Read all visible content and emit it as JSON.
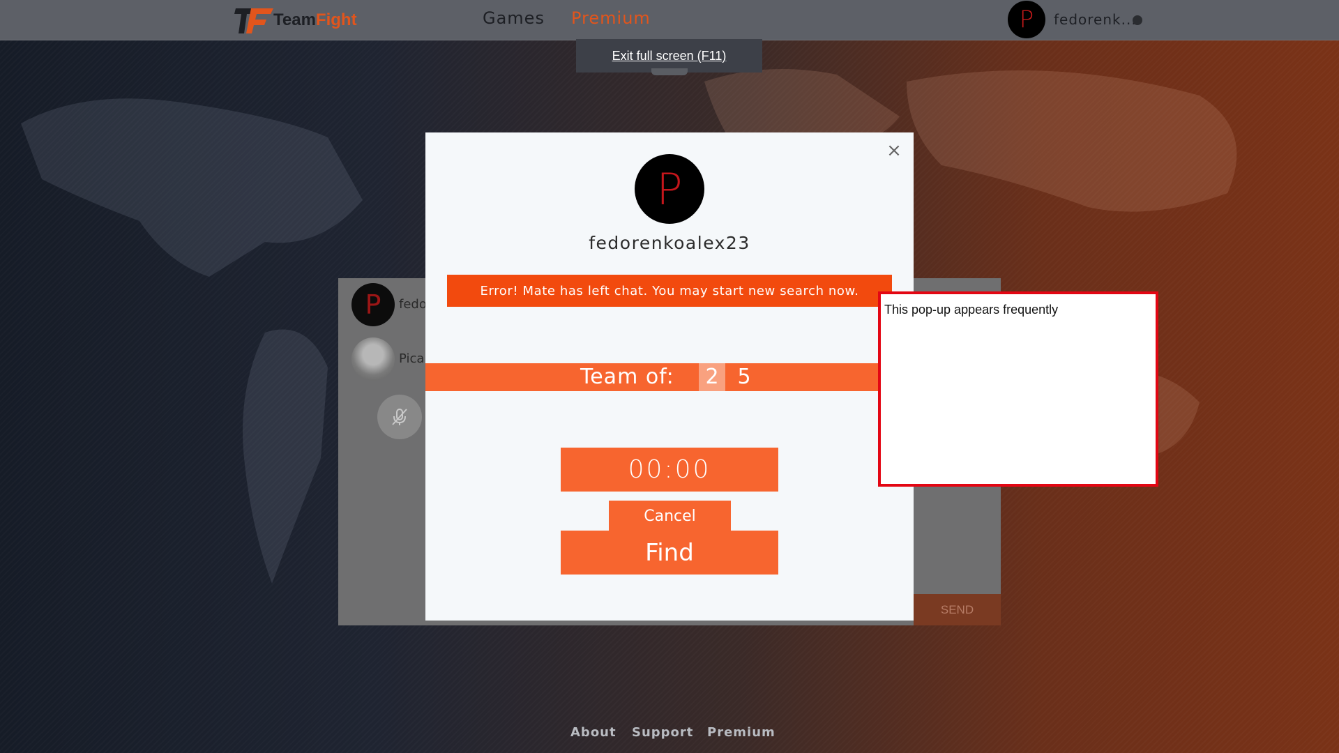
{
  "nav": {
    "logo_team": "Team",
    "logo_fight": "Fight",
    "games": "Games",
    "premium": "Premium",
    "username": "fedorenk...",
    "avatar_letter": "P"
  },
  "fullscreen_notice": "Exit full screen (F11)",
  "chat": {
    "user1_avatar_letter": "P",
    "user1_name": "fedo",
    "user2_name": "Pica",
    "send": "SEND"
  },
  "modal": {
    "close": "×",
    "avatar_letter": "P",
    "username": "fedorenkoalex23",
    "error": "Error! Mate has left chat. You may start new search now.",
    "team_label": "Team of:",
    "team_options": [
      "2",
      "5"
    ],
    "timer": "00:00",
    "cancel": "Cancel",
    "find": "Find"
  },
  "annotation": "This pop-up appears frequently",
  "footer": {
    "about": "About",
    "support": "Support",
    "premium": "Premium"
  },
  "colors": {
    "accent": "#f7652f",
    "error": "#f24a0e",
    "annotation_border": "#e30613"
  }
}
